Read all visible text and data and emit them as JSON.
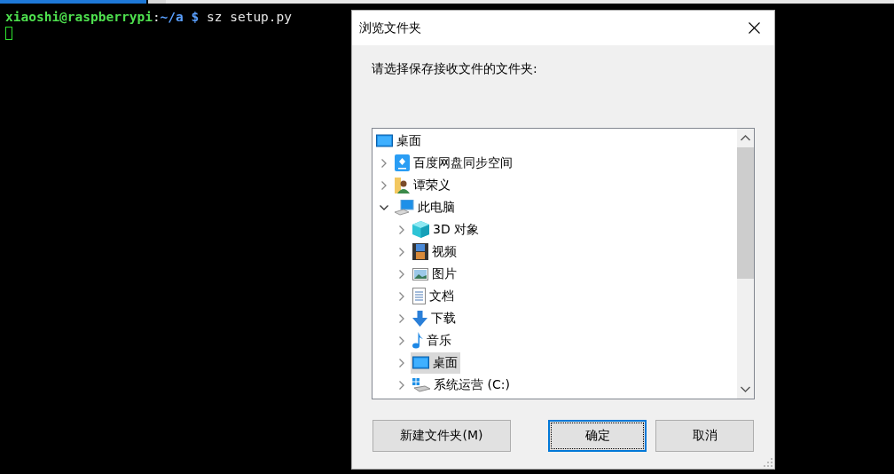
{
  "terminal": {
    "user_host": "xiaoshi@raspberrypi",
    "separator": ":",
    "path_prompt": "~/a $",
    "command": "sz setup.py"
  },
  "dialog": {
    "title": "浏览文件夹",
    "prompt": "请选择保存接收文件的文件夹:",
    "tree": [
      {
        "label": "桌面",
        "kind": "desktop",
        "selected": false,
        "children": [
          {
            "label": "百度网盘同步空间",
            "kind": "cloud",
            "expanded": false,
            "selected": false
          },
          {
            "label": "谭荣义",
            "kind": "user",
            "expanded": false,
            "selected": false
          },
          {
            "label": "此电脑",
            "kind": "computer",
            "expanded": true,
            "selected": false,
            "children": [
              {
                "label": "3D 对象",
                "kind": "cube",
                "expanded": false,
                "selected": false
              },
              {
                "label": "视频",
                "kind": "film",
                "expanded": false,
                "selected": false
              },
              {
                "label": "图片",
                "kind": "image",
                "expanded": false,
                "selected": false
              },
              {
                "label": "文档",
                "kind": "document",
                "expanded": false,
                "selected": false
              },
              {
                "label": "下载",
                "kind": "download",
                "expanded": false,
                "selected": false
              },
              {
                "label": "音乐",
                "kind": "music",
                "expanded": false,
                "selected": false
              },
              {
                "label": "桌面",
                "kind": "desktop",
                "expanded": false,
                "selected": true
              },
              {
                "label": "系统运营 (C:)",
                "kind": "drive",
                "expanded": false,
                "selected": false
              }
            ]
          }
        ]
      }
    ],
    "buttons": [
      {
        "label": "新建文件夹(M)",
        "kind": "new-folder",
        "focused": false
      },
      {
        "label": "确定",
        "kind": "ok",
        "focused": true
      },
      {
        "label": "取消",
        "kind": "cancel",
        "focused": false
      }
    ]
  }
}
